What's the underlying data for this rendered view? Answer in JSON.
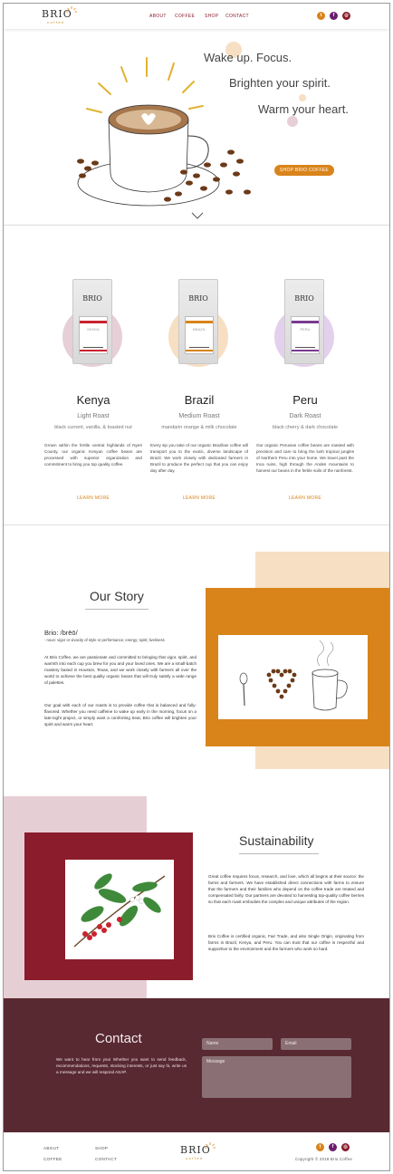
{
  "header": {
    "logo_word": "BRIO",
    "logo_sub": "coffee",
    "nav": [
      "ABOUT",
      "COFFEE",
      "SHOP",
      "CONTACT"
    ],
    "social_icons": [
      "twitter-icon",
      "facebook-icon",
      "instagram-icon"
    ],
    "social_glyphs": [
      "t",
      "f",
      "◎"
    ]
  },
  "hero": {
    "tagline_1": "Wake up. Focus.",
    "tagline_2": "Brighten your spirit.",
    "tagline_3": "Warm your heart.",
    "cta": "SHOP BRIO COFFEE"
  },
  "products": [
    {
      "name": "Kenya",
      "roast": "Light Roast",
      "notes": "black current, vanilla, & toasted nut",
      "description": "Grown within the fertile central highlands of Nyeri County, our organic Kenyan coffee beans are processed with superior organization and commitment to bring you top quality coffee.",
      "link": "LEARN MORE",
      "circle_color": "#e6cfd6",
      "band_color": "#c8242f",
      "label": "KENYA"
    },
    {
      "name": "Brazil",
      "roast": "Medium Roast",
      "notes": "mandarin orange & milk chocolate",
      "description": "Every sip you take of our organic Brazilian coffee will transport you to the exotic, diverse landscape of Brazil. We work closely with dedicated farmers in Brazil to produce the perfect cup that you can enjoy day after day.",
      "link": "LEARN MORE",
      "circle_color": "#f6dfc3",
      "band_color": "#d9841a",
      "label": "BRAZIL"
    },
    {
      "name": "Peru",
      "roast": "Dark Roast",
      "notes": "black cherry & dark chocolate",
      "description": "Our organic Peruvian coffee beans are roasted with precision and care to bring the lush tropical jungles of Northern Peru into your home. We travel past the Inca ruins, high through the Andes mountains to harvest our beans in the fertile soils of the rainforest.",
      "link": "LEARN MORE",
      "circle_color": "#e3d0ec",
      "band_color": "#7a3b8f",
      "label": "PERU"
    }
  ],
  "story": {
    "title": "Our Story",
    "pronounce": "Brio: /brēō/",
    "definition": "- noun: vigor or vivacity of style or performance; energy; spirit; liveliness",
    "p1": "At Brio Coffee, we are passionate and committed to bringing that vigor, spirit, and warmth into each cup you brew for you and your loved ones. We are a small-batch roastery based in Houston, Texas, and we work closely with farmers all over the world to achieve the best quality organic beans that will truly satisfy a wide range of palettes.",
    "p2": "Our goal with each of our roasts is to provide coffee that is balanced and fully-flavored. Whether you need caffeine to wake up early in the morning, focus on a late-night project, or simply want a comforting treat, Brio coffee will brighten your spirit and warm your heart."
  },
  "sustainability": {
    "title": "Sustainability",
    "p1": "Great coffee requires focus, research, and love, which all begins at their source: the farms and farmers. We have established direct connections with farms to ensure that the farmers and their families who depend on the coffee trade are treated and compensated fairly. Our partners are devoted to harvesting top-quality coffee berries so that each roast embodies the complex and unique attributes of the region.",
    "p2": "Brio Coffee is certified organic, Fair Trade, and also Single Origin, originating from farms in Brazil, Kenya, and Peru. You can trust that our coffee is respectful and supportive to the environment and the farmers who work so hard."
  },
  "contact": {
    "title": "Contact",
    "text": "We want to hear from you! Whether you want to send feedback, recommendations, requests, stocking interests, or just say hi, write us a message and we will respond ASAP.",
    "name_placeholder": "Name",
    "email_placeholder": "Email",
    "message_placeholder": "Message"
  },
  "footer": {
    "links": [
      "ABOUT",
      "SHOP",
      "COFFEE",
      "CONTACT"
    ],
    "copyright": "Copyright © 2018 Brio Coffee"
  },
  "colors": {
    "accent_orange": "#d9841a",
    "maroon": "#8a1c2b",
    "contact_bg": "#582931",
    "beige": "#f6dfc3",
    "pink": "#e6cfd4"
  }
}
